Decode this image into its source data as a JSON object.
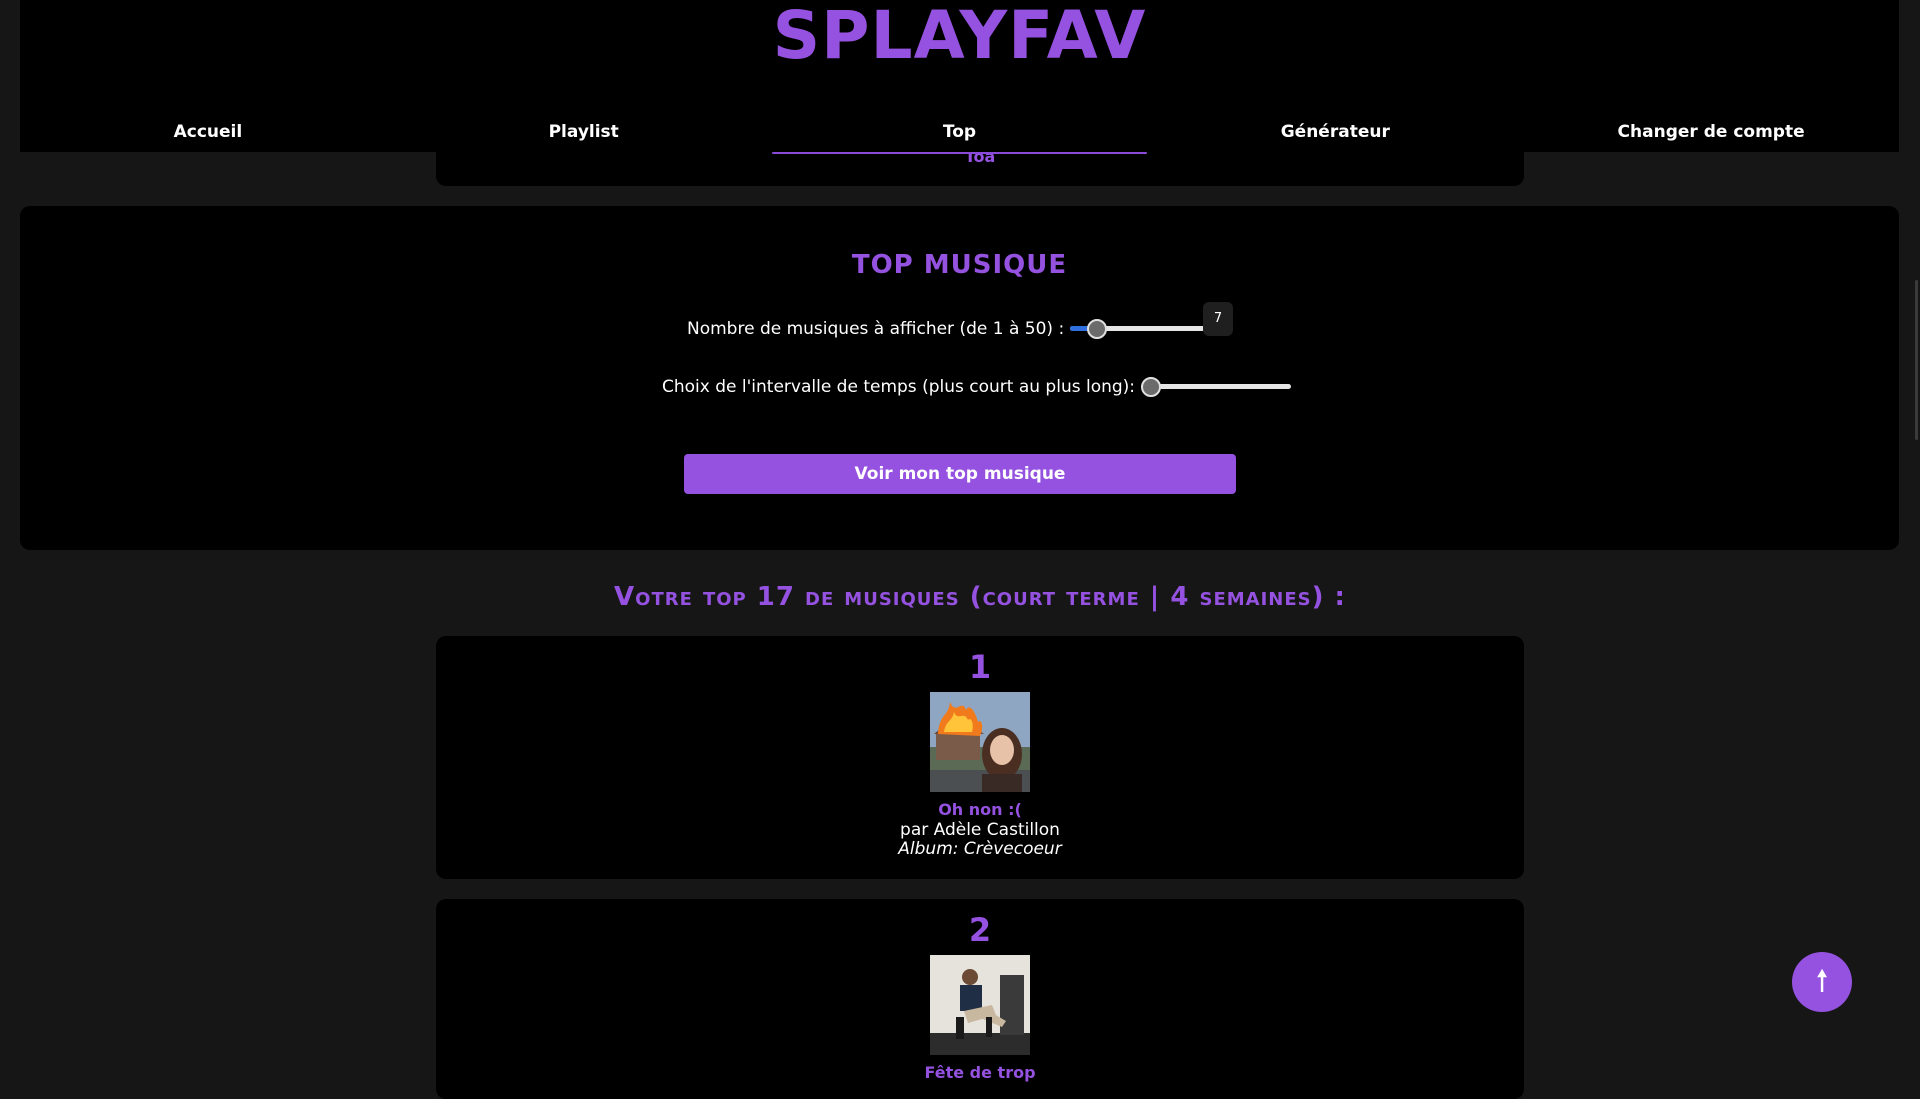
{
  "theme": {
    "accent": "#9552e0",
    "background": "#161616",
    "panel": "#000000",
    "slider_fill": "#2f6fe0"
  },
  "header": {
    "brand": "SPLAYFAV",
    "nav": [
      {
        "label": "Accueil",
        "active": false
      },
      {
        "label": "Playlist",
        "active": false
      },
      {
        "label": "Top",
        "active": true
      },
      {
        "label": "Générateur",
        "active": false
      },
      {
        "label": "Changer de compte",
        "active": false
      }
    ]
  },
  "previous_card": {
    "visible_text": "Toa"
  },
  "top_form": {
    "title": "TOP MUSIQUE",
    "count_label": "Nombre de musiques à afficher (de 1 à 50) :",
    "count_value": "7",
    "count_min": 1,
    "count_max": 50,
    "interval_label": "Choix de l'intervalle de temps (plus court au plus long):",
    "interval_level": 0,
    "submit_label": "Voir mon top musique"
  },
  "results": {
    "heading": "Votre top 17 de musiques (court terme | 4 semaines) :",
    "tracks": [
      {
        "rank": "1",
        "title": "Oh non :(",
        "artist": "par Adèle Castillon",
        "album_prefix": "Album: ",
        "album": "Crèvecoeur"
      },
      {
        "rank": "2",
        "title": "Fête de trop"
      }
    ]
  },
  "scroll_top": {
    "icon": "arrow-up-icon",
    "glyph": "🠕"
  }
}
